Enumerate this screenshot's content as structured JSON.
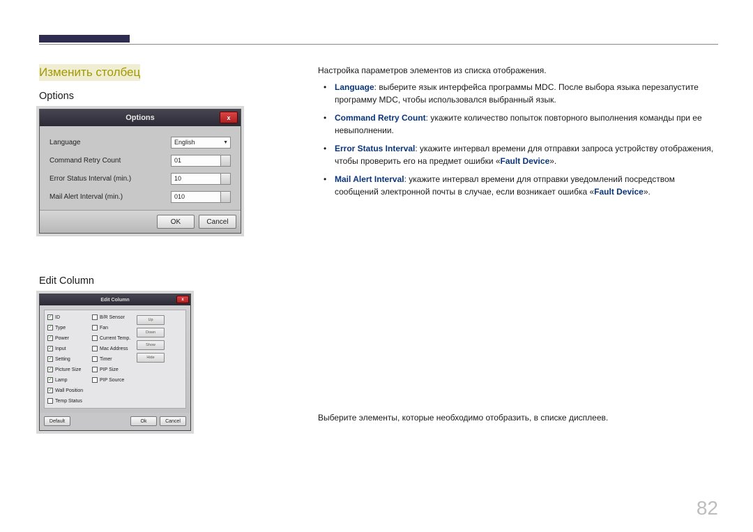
{
  "page_number": "82",
  "section_title": "Изменить столбец",
  "left": {
    "options_heading": "Options",
    "editcol_heading": "Edit Column"
  },
  "options_dialog": {
    "title": "Options",
    "close": "x",
    "rows": {
      "language_label": "Language",
      "language_value": "English",
      "retry_label": "Command Retry Count",
      "retry_value": "01",
      "error_label": "Error Status Interval (min.)",
      "error_value": "10",
      "mail_label": "Mail Alert Interval (min.)",
      "mail_value": "010"
    },
    "ok": "OK",
    "cancel": "Cancel"
  },
  "editcol_dialog": {
    "title": "Edit Column",
    "close": "x",
    "col1": [
      "ID",
      "Type",
      "Power",
      "Input",
      "Setting",
      "Picture Size",
      "Lamp",
      "Wall Position",
      "Temp Status"
    ],
    "col1_checked": [
      true,
      true,
      true,
      true,
      true,
      true,
      true,
      true,
      false
    ],
    "col2": [
      "B/R Sensor",
      "Fan",
      "Current Temp.",
      "Mac Address",
      "Timer",
      "PIP Size",
      "PIP Source"
    ],
    "col2_checked": [
      false,
      false,
      false,
      false,
      false,
      false,
      false
    ],
    "side_buttons": [
      "Up",
      "Down",
      "Show",
      "Hide"
    ],
    "default_btn": "Default",
    "ok": "Ok",
    "cancel": "Cancel"
  },
  "right": {
    "intro": "Настройка параметров элементов из списка отображения.",
    "items": {
      "lang_bold": "Language",
      "lang_text": ": выберите язык интерфейса программы MDC. После выбора языка перезапустите программу MDC, чтобы использовался выбранный язык.",
      "retry_bold": "Command Retry Count",
      "retry_text": ": укажите количество попыток повторного выполнения команды при ее невыполнении.",
      "error_bold": "Error Status Interval",
      "error_text1": ": укажите интервал времени для отправки запроса устройству отображения, чтобы проверить его на предмет ошибки «",
      "fault_device": "Fault Device",
      "error_text2": "».",
      "mail_bold": "Mail Alert Interval",
      "mail_text1": ": укажите интервал времени для отправки уведомлений посредством сообщений электронной почты в случае, если возникает ошибка «",
      "mail_text2": "»."
    },
    "editcol_desc": "Выберите элементы, которые необходимо отобразить, в списке дисплеев."
  }
}
